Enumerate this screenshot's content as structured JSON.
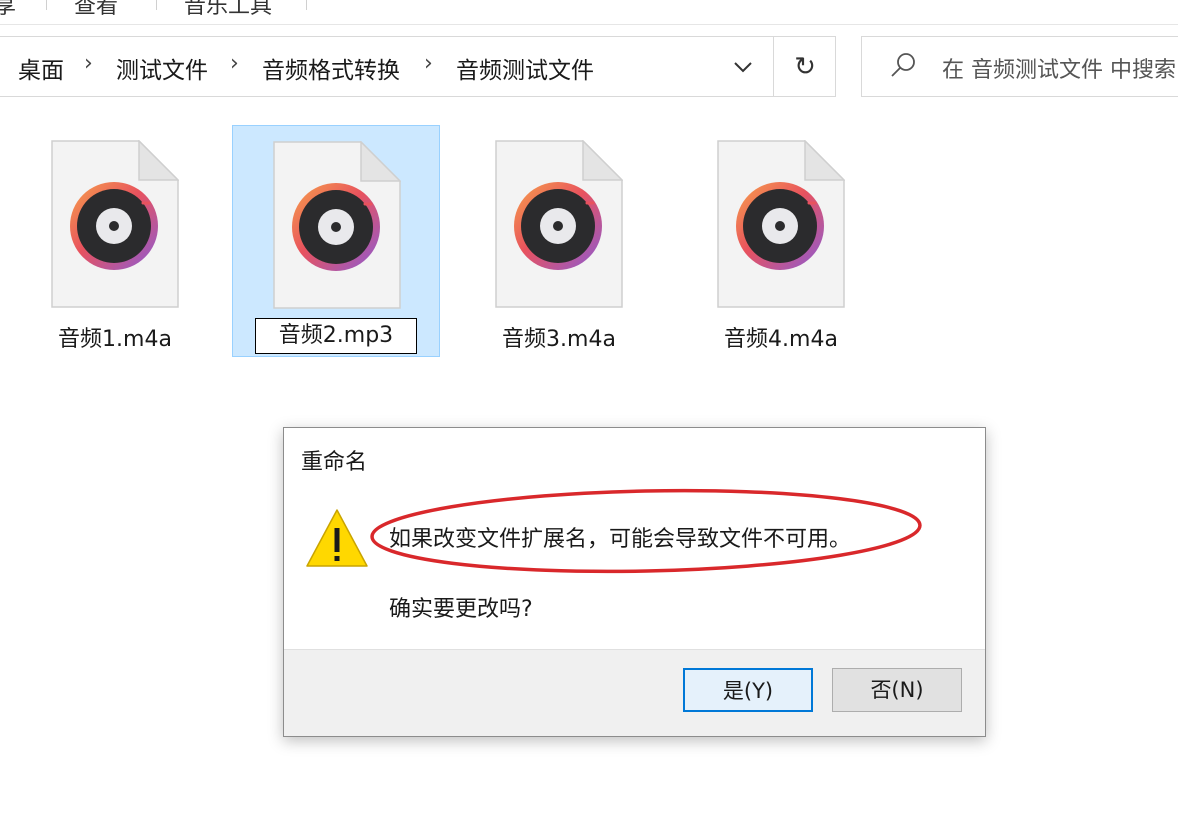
{
  "ribbon": {
    "tabs": [
      "享",
      "查看",
      "音乐工具"
    ]
  },
  "breadcrumb": {
    "items": [
      "桌面",
      "测试文件",
      "音频格式转换",
      "音频测试文件"
    ],
    "separator": "›"
  },
  "refresh_glyph": "↻",
  "search": {
    "placeholder": "在 音频测试文件 中搜索"
  },
  "files": [
    {
      "name": "音频1.m4a",
      "selected": false
    },
    {
      "name": "音频2.mp3",
      "selected": true,
      "renaming": true
    },
    {
      "name": "音频3.m4a",
      "selected": false
    },
    {
      "name": "音频4.m4a",
      "selected": false
    }
  ],
  "dialog": {
    "title": "重命名",
    "message": "如果改变文件扩展名，可能会导致文件不可用。",
    "question": "确实要更改吗?",
    "yes_label": "是(Y)",
    "no_label": "否(N)",
    "icon": "warning-icon"
  },
  "colors": {
    "selection_bg": "#cce8ff",
    "selection_border": "#99d1ff",
    "annotation_red": "#d9282b",
    "default_button_border": "#0078d7"
  }
}
